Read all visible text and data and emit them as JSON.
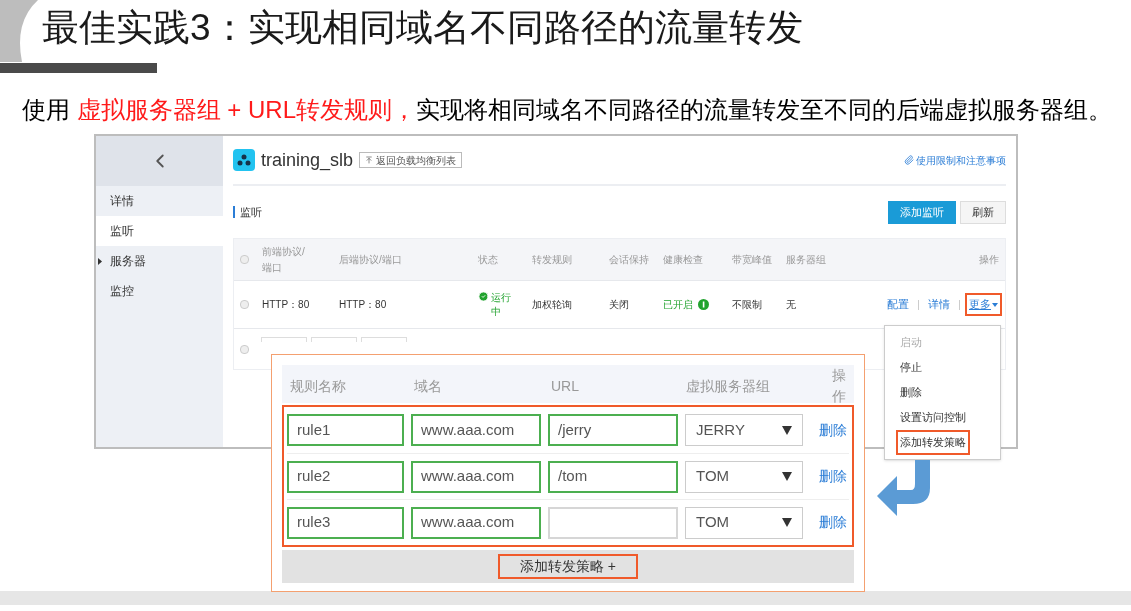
{
  "slide": {
    "title": "最佳实践3：实现相同域名不同路径的流量转发",
    "subtitle": [
      {
        "text": "使用 ",
        "highlight": false
      },
      {
        "text": "虚拟服务器组 + URL转发规则，",
        "highlight": true
      },
      {
        "text": "实现将相同域名不同路径的流量转发至不同的后端虚拟服务器组。",
        "highlight": false
      }
    ]
  },
  "console": {
    "sidebar": [
      {
        "label": "详情",
        "selected": false,
        "expandable": false
      },
      {
        "label": "监听",
        "selected": true,
        "expandable": false
      },
      {
        "label": "服务器",
        "selected": false,
        "expandable": true
      },
      {
        "label": "监控",
        "selected": false,
        "expandable": false
      }
    ],
    "header": {
      "name": "training_slb",
      "back_link": "返回负载均衡列表",
      "notice_link": "使用限制和注意事项"
    },
    "section": "监听",
    "buttons": [
      {
        "label": "添加监听",
        "kind": "primary"
      },
      {
        "label": "刷新",
        "kind": "default"
      }
    ],
    "table": {
      "columns": [
        "前端协议/端口",
        "后端协议/端口",
        "状态",
        "转发规则",
        "会话保持",
        "健康检查",
        "带宽峰值",
        "服务器组",
        "操作"
      ],
      "select_all_checked": false,
      "draft_row": {
        "checked": false
      },
      "rows": [
        {
          "checked": false,
          "frontend": "HTTP：80",
          "backend": "HTTP：80",
          "status": "运行中",
          "rule": "加权轮询",
          "session": "关闭",
          "health": "已开启",
          "bandwidth": "不限制",
          "group": "无",
          "actions": [
            {
              "label": "配置",
              "kind": "link",
              "highlighted": false
            },
            {
              "label": "详情",
              "kind": "link",
              "highlighted": false
            },
            {
              "label": "更多",
              "kind": "menu",
              "highlighted": true
            }
          ]
        }
      ]
    },
    "more_menu": [
      {
        "label": "启动",
        "disabled": true,
        "highlighted": false
      },
      {
        "label": "停止",
        "disabled": false,
        "highlighted": false
      },
      {
        "label": "删除",
        "disabled": false,
        "highlighted": false
      },
      {
        "label": "设置访问控制",
        "disabled": false,
        "highlighted": false
      },
      {
        "label": "添加转发策略",
        "disabled": false,
        "highlighted": true
      }
    ]
  },
  "rule_panel": {
    "columns": [
      "规则名称",
      "域名",
      "URL",
      "虚拟服务器组",
      "操作"
    ],
    "rules": [
      {
        "name": {
          "value": "rule1",
          "valid": true
        },
        "domain": {
          "value": "www.aaa.com",
          "valid": true
        },
        "url": {
          "value": "/jerry",
          "valid": true
        },
        "group": "JERRY",
        "action": "删除"
      },
      {
        "name": {
          "value": "rule2",
          "valid": true
        },
        "domain": {
          "value": "www.aaa.com",
          "valid": true
        },
        "url": {
          "value": "/tom",
          "valid": true
        },
        "group": "TOM",
        "action": "删除"
      },
      {
        "name": {
          "value": "rule3",
          "valid": true
        },
        "domain": {
          "value": "www.aaa.com",
          "valid": true
        },
        "url": {
          "valid": false
        },
        "group": "TOM",
        "action": "删除"
      }
    ],
    "add_button": "添加转发策略 +"
  }
}
